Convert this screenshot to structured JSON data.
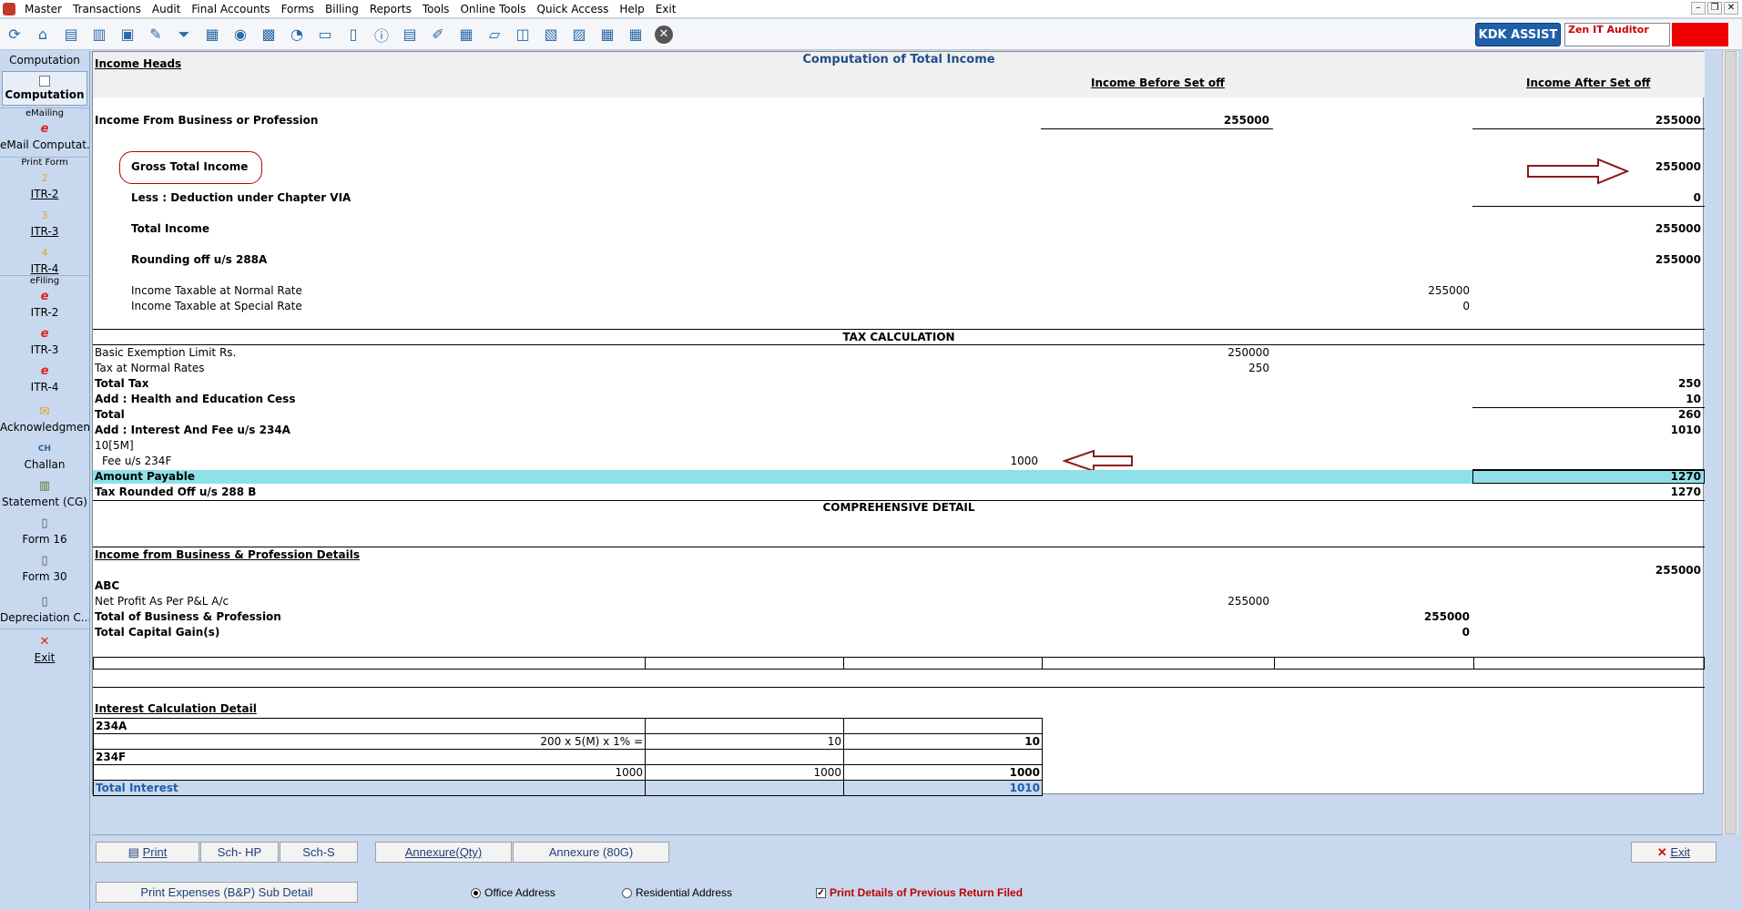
{
  "menu": [
    "Master",
    "Transactions",
    "Audit",
    "Final Accounts",
    "Forms",
    "Billing",
    "Reports",
    "Tools",
    "Online Tools",
    "Quick Access",
    "Help",
    "Exit"
  ],
  "toolbar_icons": [
    "refresh-icon",
    "home-icon",
    "ledger-icon",
    "chart-icon",
    "gift-icon",
    "tools-icon",
    "filter-icon",
    "tax-icon",
    "media-icon",
    "calculator-icon",
    "pie-icon",
    "pay-icon",
    "book-icon",
    "info-icon",
    "report-icon",
    "edit-icon",
    "calendar-icon",
    "folder-add-icon",
    "window-icon",
    "bs-icon",
    "tax2-icon",
    "3cd-icon",
    "grid-icon",
    "close-icon"
  ],
  "header": {
    "kdk_label": "KDK ASSIST",
    "user_label": "Zen IT Auditor"
  },
  "sidebar": {
    "top": "Computation",
    "active": "Computation",
    "sections": {
      "emailing": "eMailing",
      "print_form": "Print Form",
      "efiling": "eFiling"
    },
    "items": {
      "email": "eMail Computat...",
      "itr2": "ITR-2",
      "itr3": "ITR-3",
      "itr4": "ITR-4",
      "e_itr2": "ITR-2",
      "e_itr3": "ITR-3",
      "e_itr4": "ITR-4",
      "ack": "Acknowledgment",
      "challan": "Challan",
      "statement": "Statement (CG)",
      "form16": "Form 16",
      "form30": "Form 30",
      "depreciation": "Depreciation C...",
      "exit": "Exit"
    },
    "numbers": {
      "n2": "2",
      "n3": "3",
      "n4": "4"
    },
    "icon_text": {
      "ch": "CH"
    }
  },
  "report": {
    "title": "Computation of Total Income",
    "income_heads": "Income Heads",
    "col_before": "Income Before Set off",
    "col_after": "Income After Set off",
    "business_label": "Income From Business or Profession",
    "business_before": "255000",
    "business_after": "255000",
    "gti_label": "Gross Total Income",
    "gti_value": "255000",
    "deduction_label": "Less : Deduction under Chapter VIA",
    "deduction_value": "0",
    "total_income_label": "Total Income",
    "total_income_value": "255000",
    "rounding_label": "Rounding off u/s 288A",
    "rounding_value": "255000",
    "normal_rate_label": "Income Taxable at Normal Rate",
    "normal_rate_value": "255000",
    "special_rate_label": "Income Taxable at Special Rate",
    "special_rate_value": "0",
    "tax_calc_title": "TAX CALCULATION",
    "exemption_label": "Basic Exemption Limit Rs.",
    "exemption_value": "250000",
    "normal_tax_label": "Tax at Normal Rates",
    "normal_tax_value": "250",
    "total_tax_label": "Total Tax",
    "total_tax_value": "250",
    "cess_label": "Add : Health and Education Cess",
    "cess_value": "10",
    "total_label": "Total",
    "total_value": "260",
    "interest_label": "Add : Interest And Fee  u/s 234A",
    "interest_value": "1010",
    "interest_sub": "10[5M]",
    "fee_label": "Fee u/s 234F",
    "fee_value": "1000",
    "payable_label": "Amount Payable",
    "payable_value": "1270",
    "rounded_label": "Tax Rounded Off u/s 288 B",
    "rounded_value": "1270",
    "comprehensive_title": "COMPREHENSIVE DETAIL",
    "business_details_title": "Income from Business & Profession Details",
    "abc_label": "ABC",
    "abc_value": "255000",
    "net_profit_label": "Net Profit As Per P&L A/c",
    "net_profit_value": "255000",
    "total_business_label": "Total of Business & Profession",
    "total_business_value": "255000",
    "total_cg_label": "Total Capital Gain(s)",
    "total_cg_value": "0",
    "interest_detail_title": "Interest Calculation Detail",
    "int_rows": [
      {
        "c1": "234A",
        "c2": "",
        "c3": "",
        "bold": true,
        "left": true
      },
      {
        "c1": "200 x 5(M) x 1%  =",
        "c2": "10",
        "c3": "10",
        "bold": false,
        "left": false
      },
      {
        "c1": "234F",
        "c2": "",
        "c3": "",
        "bold": true,
        "left": true
      },
      {
        "c1": "1000",
        "c2": "1000",
        "c3": "1000",
        "bold": false,
        "left": false
      }
    ],
    "total_interest_label": "Total Interest",
    "total_interest_value": "1010"
  },
  "bottom": {
    "print": "Print",
    "sch_hp": "Sch- HP",
    "sch_s": "Sch-S",
    "annexure_qty": "Annexure(Qty)",
    "annexure_80g": "Annexure (80G)",
    "exit": "Exit",
    "print_expenses": "Print Expenses (B&P) Sub Detail",
    "office_address": "Office Address",
    "residential_address": "Residential Address",
    "print_prev_return": "Print Details of Previous Return Filed",
    "office_selected": true,
    "prev_checked": true
  },
  "colors": {
    "highlight": "#8fe0e8",
    "title_blue": "#1f4f8a",
    "annotation_red": "#c00000"
  }
}
